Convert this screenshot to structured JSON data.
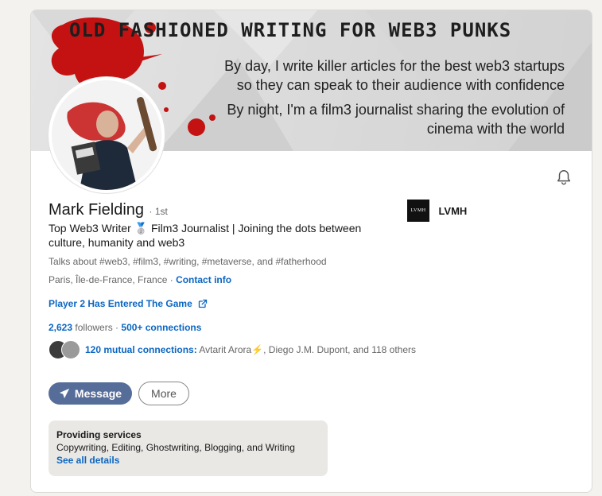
{
  "banner": {
    "title": "OLD FASHIONED WRITING FOR WEB3 PUNKS",
    "line1": "By day, I write killer articles for the best web3 startups",
    "line2": "so they can speak to their audience with confidence",
    "line3": "By night, I'm a film3 journalist sharing the evolution of",
    "line4": "cinema with the world"
  },
  "profile": {
    "name": "Mark Fielding",
    "degree": "· 1st",
    "headline": "Top Web3 Writer 🥈 Film3 Journalist | Joining the dots between culture, humanity and web3",
    "talks_about": "Talks about #web3, #film3, #writing, #metaverse, and #fatherhood",
    "location": "Paris, Île-de-France, France",
    "location_sep": " · ",
    "contact_info": "Contact info",
    "website": "Player 2 Has Entered The Game",
    "followers_count": "2,623",
    "followers_label": " followers",
    "connections_sep": " · ",
    "connections": "500+ connections",
    "mutual_label": "120 mutual connections:",
    "mutual_names": " Avtarit Arora⚡, Diego J.M. Dupont, and 118 others"
  },
  "company": {
    "logo_text": "LVMH",
    "name": "LVMH"
  },
  "actions": {
    "message": "Message",
    "more": "More"
  },
  "services": {
    "title": "Providing services",
    "list": "Copywriting, Editing, Ghostwriting, Blogging, and Writing",
    "see_all": "See all details"
  },
  "icons": {
    "bell": "bell-icon",
    "send": "send-icon",
    "external": "external-link-icon"
  },
  "colors": {
    "link": "#0a66c2",
    "message_button": "#566d9a",
    "banner_splash": "#c41212"
  }
}
